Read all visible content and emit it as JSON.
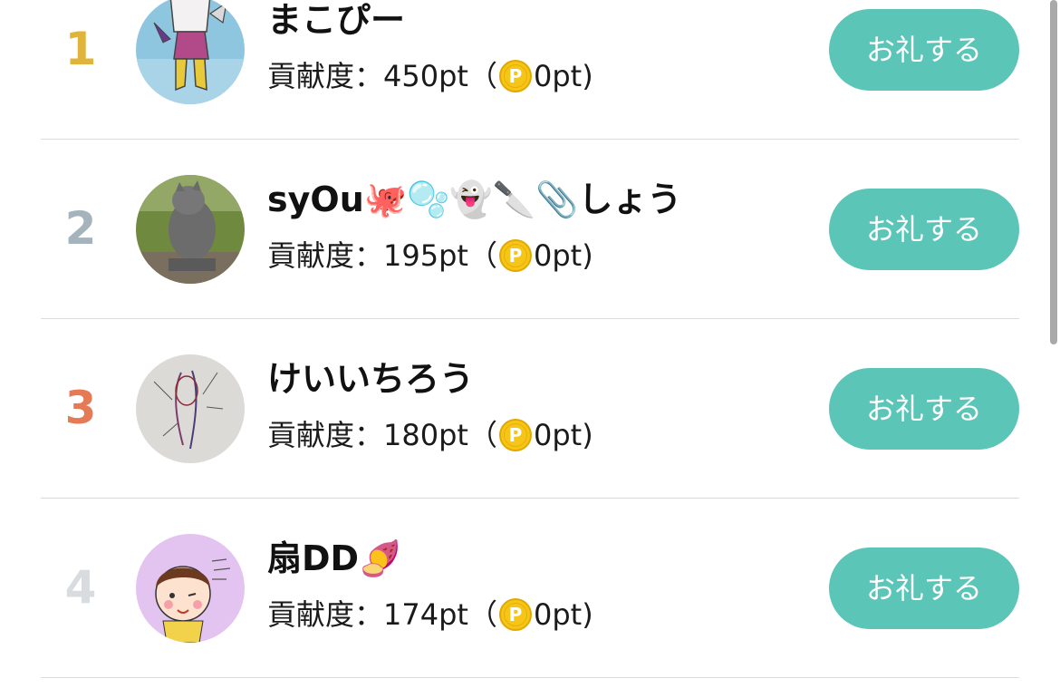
{
  "colors": {
    "accent": "#5bc5b8",
    "rank_gold": "#e0b43a",
    "rank_silver": "#a5b3bd",
    "rank_bronze": "#e57a55",
    "rank_default": "#d8dcde",
    "coin_fill": "#f5c518",
    "coin_ring": "#e2a800"
  },
  "ranking": [
    {
      "rank": "1",
      "name": "まこぴー",
      "score_label": "貢献度：",
      "points": "450pt",
      "paren_open": "（",
      "coin_icon": "p-coin-icon",
      "coin_points": "0pt)",
      "button_label": "お礼する"
    },
    {
      "rank": "2",
      "name": "syOu🐙🫧👻🔪📎しょう",
      "score_label": "貢献度：",
      "points": "195pt",
      "paren_open": "（",
      "coin_icon": "p-coin-icon",
      "coin_points": "0pt)",
      "button_label": "お礼する"
    },
    {
      "rank": "3",
      "name": "けいいちろう",
      "score_label": "貢献度：",
      "points": "180pt",
      "paren_open": "（",
      "coin_icon": "p-coin-icon",
      "coin_points": "0pt)",
      "button_label": "お礼する"
    },
    {
      "rank": "4",
      "name": "扇DD🍠",
      "score_label": "貢献度：",
      "points": "174pt",
      "paren_open": "（",
      "coin_icon": "p-coin-icon",
      "coin_points": "0pt)",
      "button_label": "お礼する"
    }
  ]
}
